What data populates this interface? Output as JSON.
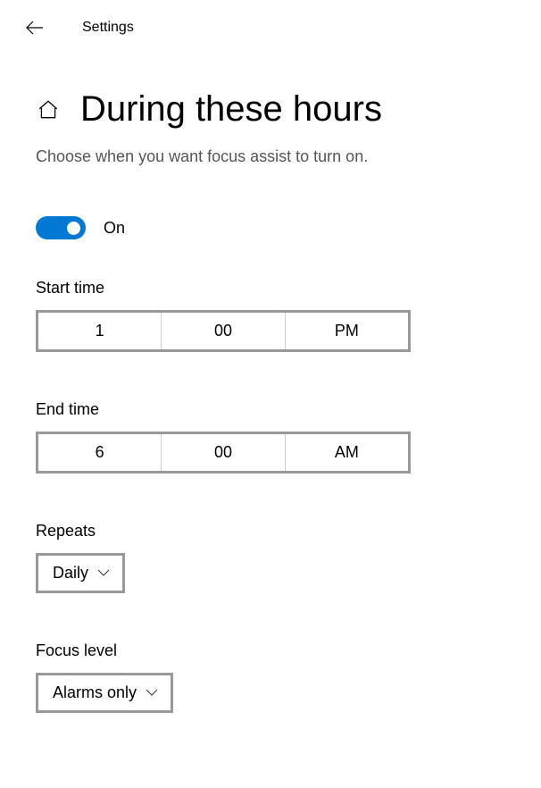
{
  "topbar": {
    "title": "Settings"
  },
  "page": {
    "title": "During these hours",
    "description": "Choose when you want focus assist to turn on."
  },
  "toggle": {
    "state_label": "On"
  },
  "start_time": {
    "label": "Start time",
    "hour": "1",
    "minute": "00",
    "ampm": "PM"
  },
  "end_time": {
    "label": "End time",
    "hour": "6",
    "minute": "00",
    "ampm": "AM"
  },
  "repeats": {
    "label": "Repeats",
    "value": "Daily"
  },
  "focus_level": {
    "label": "Focus level",
    "value": "Alarms only"
  }
}
